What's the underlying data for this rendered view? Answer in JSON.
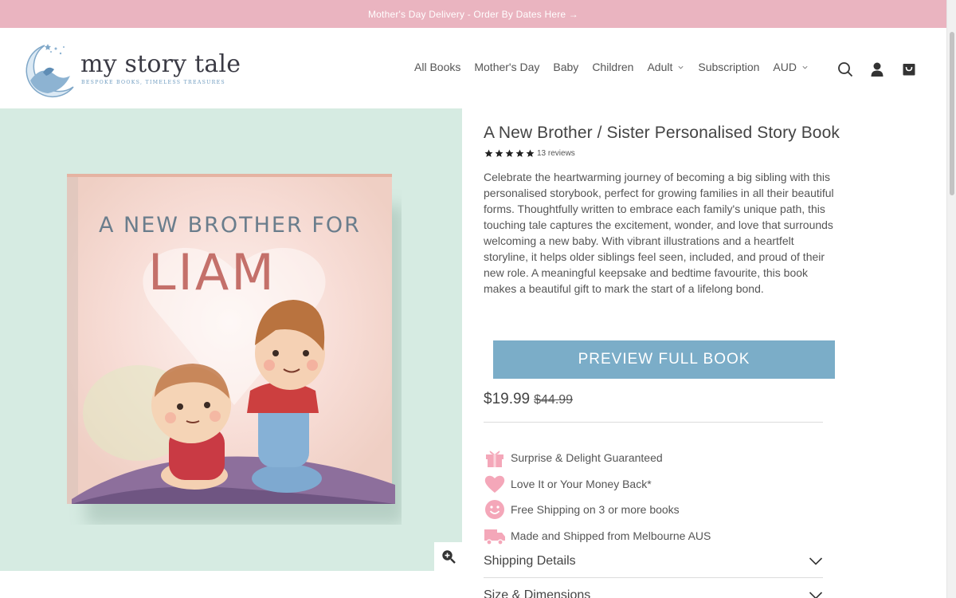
{
  "announcement": {
    "text": "Mother's Day Delivery - Order By Dates Here →"
  },
  "brand": {
    "name": "my story tale",
    "tagline": "BESPOKE BOOKS, TIMELESS TREASURES"
  },
  "nav": {
    "items": [
      {
        "label": "All Books",
        "has_dropdown": false
      },
      {
        "label": "Mother's Day",
        "has_dropdown": false
      },
      {
        "label": "Baby",
        "has_dropdown": false
      },
      {
        "label": "Children",
        "has_dropdown": false
      },
      {
        "label": "Adult",
        "has_dropdown": true
      },
      {
        "label": "Subscription",
        "has_dropdown": false
      },
      {
        "label": "AUD",
        "has_dropdown": true
      }
    ],
    "icons": [
      "search-icon",
      "account-icon",
      "cart-icon"
    ]
  },
  "product": {
    "cover": {
      "line1": "A NEW BROTHER FOR",
      "line2": "LIAM"
    },
    "title": "A New Brother / Sister Personalised Story Book",
    "rating": {
      "stars": 5,
      "reviews_text": "13 reviews"
    },
    "description": "Celebrate the heartwarming journey of becoming a big sibling with this personalised storybook, perfect for growing families in all their beautiful forms. Thoughtfully written to embrace each family's unique path, this touching tale captures the excitement, wonder, and love that surrounds welcoming a new baby. With vibrant illustrations and a heartfelt storyline, it helps older siblings feel seen, included, and proud of their new role. A meaningful keepsake and bedtime favourite, this book makes a beautiful gift to mark the start of a lifelong bond.",
    "preview_button": "PREVIEW FULL BOOK",
    "price": "$19.99",
    "compare_price": "$44.99"
  },
  "features": [
    {
      "icon": "gift-icon",
      "text": "Surprise & Delight Guaranteed"
    },
    {
      "icon": "heart-icon",
      "text": "Love It or Your Money Back*"
    },
    {
      "icon": "smiley-icon",
      "text": "Free Shipping on 3 or more books"
    },
    {
      "icon": "truck-icon",
      "text": "Made and Shipped from Melbourne AUS"
    }
  ],
  "accordions": [
    {
      "label": "Shipping Details"
    },
    {
      "label": "Size & Dimensions"
    }
  ],
  "colors": {
    "announcement_bg": "#eab4c0",
    "gallery_bg": "#d6ebe2",
    "preview_button_bg": "#7badc8",
    "feature_icon": "#f4a7b9"
  }
}
